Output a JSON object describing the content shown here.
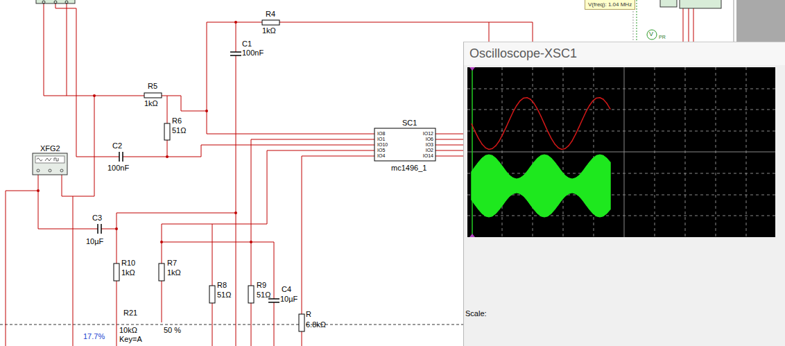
{
  "tooltip": {
    "text": "V(freq): 1.04 MHz"
  },
  "probe": {
    "label": "PR",
    "symbol": "V"
  },
  "generator": {
    "label": "XFG2"
  },
  "components": [
    {
      "label": "R4",
      "value": "1kΩ",
      "kind": "resistor"
    },
    {
      "label": "C1",
      "value": "100nF",
      "kind": "capacitor"
    },
    {
      "label": "R5",
      "value": "1kΩ",
      "kind": "resistor"
    },
    {
      "label": "R6",
      "value": "51Ω",
      "kind": "resistor"
    },
    {
      "label": "C2",
      "value": "100nF",
      "kind": "capacitor"
    },
    {
      "label": "C3",
      "value": "10µF",
      "kind": "capacitor"
    },
    {
      "label": "R10",
      "value": "1kΩ",
      "kind": "resistor"
    },
    {
      "label": "R7",
      "value": "1kΩ",
      "kind": "resistor"
    },
    {
      "label": "R8",
      "value": "51Ω",
      "kind": "resistor"
    },
    {
      "label": "R9",
      "value": "51Ω",
      "kind": "resistor"
    },
    {
      "label": "C4",
      "value": "10µF",
      "kind": "capacitor"
    },
    {
      "label": "R",
      "value": "6.8kΩ",
      "kind": "resistor"
    }
  ],
  "chip": {
    "label": "SC1",
    "part": "mc1496_1",
    "pins_left": [
      "IO8",
      "IO1",
      "IO10",
      "IO5",
      "IO4"
    ],
    "pins_right": [
      "IO12",
      "IO6",
      "IO3",
      "IO2",
      "IO14"
    ]
  },
  "potentiometer": {
    "label": "R21",
    "value": "10kΩ",
    "setting": "50 %",
    "key": "Key=A",
    "reading": "17.7%"
  },
  "oscilloscope": {
    "title": "Oscilloscope-XSC1",
    "scale_label": "Scale:",
    "channel_a": {
      "color": "#d01818",
      "values": [
        -0.02,
        -0.39,
        -0.72,
        -0.99,
        -1.17,
        -1.25,
        -1.21,
        -1.07,
        -0.84,
        -0.52,
        -0.17,
        0.2,
        0.56,
        0.86,
        1.09,
        1.22,
        1.24,
        1.16,
        0.97,
        0.69,
        0.35,
        -0.02,
        -0.39,
        -0.72,
        -0.99,
        -1.17,
        -1.25,
        -1.21,
        -1.07,
        -0.84,
        -0.52,
        -0.17,
        0.2,
        0.56,
        0.86,
        1.09,
        1.22,
        1.24,
        1.16,
        0.97,
        0.69
      ]
    },
    "channel_b": {
      "color": "#1ee81e",
      "envelope": [
        0.69,
        0.92,
        1.14,
        1.33,
        1.46,
        1.5,
        1.46,
        1.33,
        1.14,
        0.92,
        0.69,
        0.5,
        0.38,
        0.33,
        0.38,
        0.5,
        0.69,
        0.92,
        1.14,
        1.33,
        1.46,
        1.5,
        1.46,
        1.33,
        1.14,
        0.92,
        0.69,
        0.5,
        0.38,
        0.33,
        0.38,
        0.5,
        0.69,
        0.92,
        1.14,
        1.33,
        1.46,
        1.5,
        1.46,
        1.33,
        1.14
      ]
    }
  }
}
